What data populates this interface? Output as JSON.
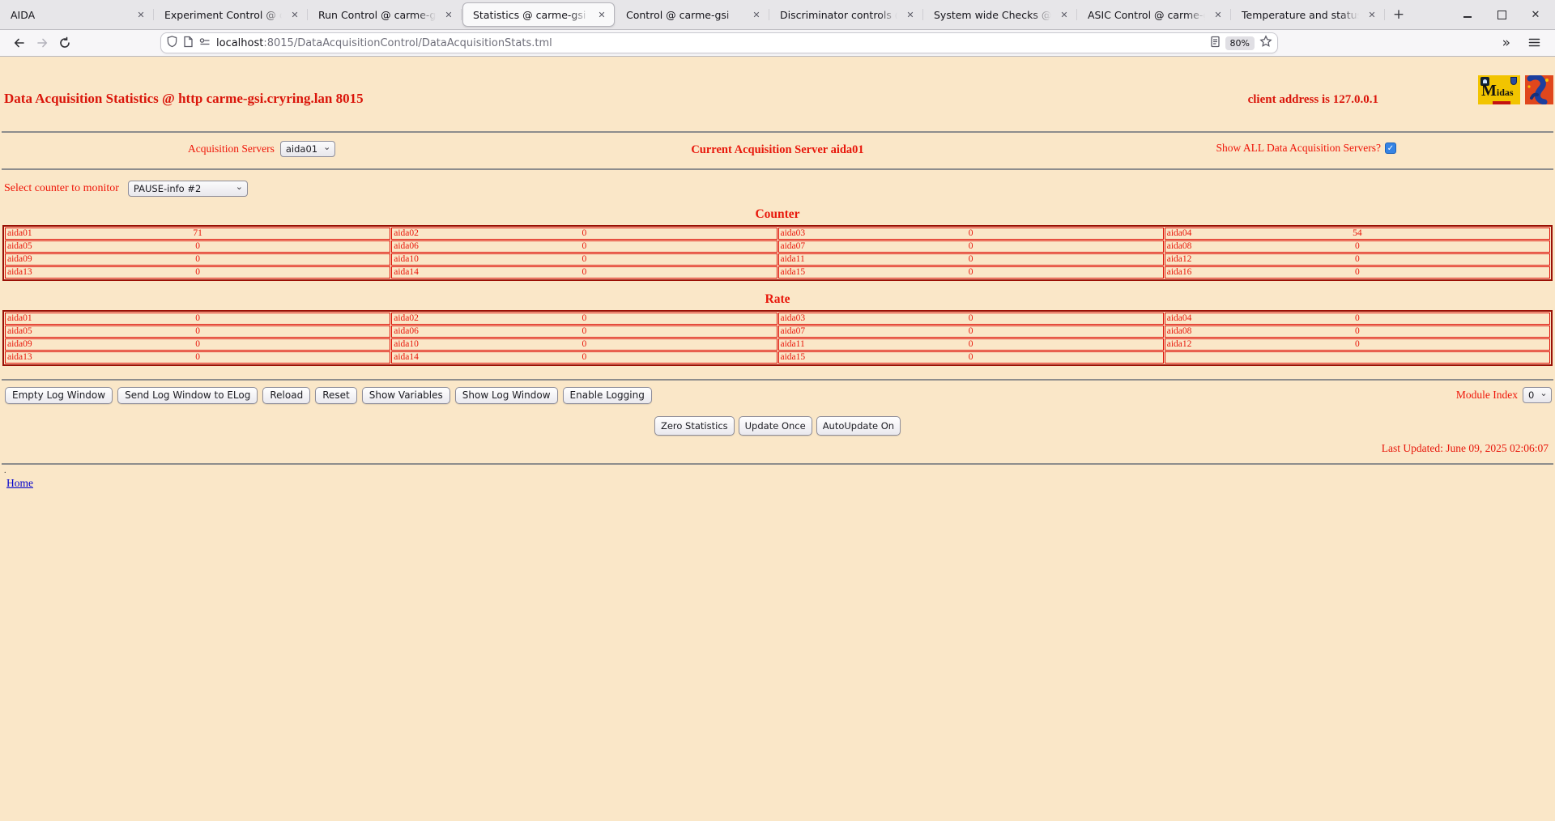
{
  "browser": {
    "tabs": [
      {
        "label": "AIDA",
        "active": false
      },
      {
        "label": "Experiment Control @ ca",
        "active": false
      },
      {
        "label": "Run Control @ carme-gs",
        "active": false
      },
      {
        "label": "Statistics @ carme-gsi",
        "active": true
      },
      {
        "label": "Control @ carme-gsi",
        "active": false
      },
      {
        "label": "Discriminator controls @",
        "active": false
      },
      {
        "label": "System wide Checks @ c",
        "active": false
      },
      {
        "label": "ASIC Control @ carme-g",
        "active": false
      },
      {
        "label": "Temperature and status s",
        "active": false
      }
    ],
    "url": {
      "host": "localhost",
      "path": ":8015/DataAcquisitionControl/DataAcquisitionStats.tml"
    },
    "zoom_badge": "80%"
  },
  "page": {
    "title": "Data Acquisition Statistics @ http carme-gsi.cryring.lan 8015",
    "client_address": "client address is 127.0.0.1",
    "logos": {
      "midas_word": "Midas"
    },
    "acquisition_servers_label": "Acquisition Servers",
    "acquisition_server_selected": "aida01",
    "current_server_text": "Current Acquisition Server aida01",
    "show_all_label": "Show ALL Data Acquisition Servers?",
    "show_all_checked": true,
    "counter_select_label": "Select counter to monitor",
    "counter_selected": "PAUSE-info #2",
    "counter_heading": "Counter",
    "rate_heading": "Rate",
    "counter_rows": [
      [
        {
          "name": "aida01",
          "value": "71"
        },
        {
          "name": "aida02",
          "value": "0"
        },
        {
          "name": "aida03",
          "value": "0"
        },
        {
          "name": "aida04",
          "value": "54"
        }
      ],
      [
        {
          "name": "aida05",
          "value": "0"
        },
        {
          "name": "aida06",
          "value": "0"
        },
        {
          "name": "aida07",
          "value": "0"
        },
        {
          "name": "aida08",
          "value": "0"
        }
      ],
      [
        {
          "name": "aida09",
          "value": "0"
        },
        {
          "name": "aida10",
          "value": "0"
        },
        {
          "name": "aida11",
          "value": "0"
        },
        {
          "name": "aida12",
          "value": "0"
        }
      ],
      [
        {
          "name": "aida13",
          "value": "0"
        },
        {
          "name": "aida14",
          "value": "0"
        },
        {
          "name": "aida15",
          "value": "0"
        },
        {
          "name": "aida16",
          "value": "0"
        }
      ]
    ],
    "rate_rows": [
      [
        {
          "name": "aida01",
          "value": "0"
        },
        {
          "name": "aida02",
          "value": "0"
        },
        {
          "name": "aida03",
          "value": "0"
        },
        {
          "name": "aida04",
          "value": "0"
        }
      ],
      [
        {
          "name": "aida05",
          "value": "0"
        },
        {
          "name": "aida06",
          "value": "0"
        },
        {
          "name": "aida07",
          "value": "0"
        },
        {
          "name": "aida08",
          "value": "0"
        }
      ],
      [
        {
          "name": "aida09",
          "value": "0"
        },
        {
          "name": "aida10",
          "value": "0"
        },
        {
          "name": "aida11",
          "value": "0"
        },
        {
          "name": "aida12",
          "value": "0"
        }
      ],
      [
        {
          "name": "aida13",
          "value": "0"
        },
        {
          "name": "aida14",
          "value": "0"
        },
        {
          "name": "aida15",
          "value": "0"
        },
        {
          "name": "",
          "value": ""
        }
      ]
    ],
    "log_buttons": [
      "Empty Log Window",
      "Send Log Window to ELog",
      "Reload",
      "Reset",
      "Show Variables",
      "Show Log Window",
      "Enable Logging"
    ],
    "module_index_label": "Module Index",
    "module_index_selected": "0",
    "stat_buttons": [
      "Zero Statistics",
      "Update Once",
      "AutoUpdate On"
    ],
    "last_updated": "Last Updated: June 09, 2025 02:06:07",
    "dot": ".",
    "home_link": "Home"
  }
}
